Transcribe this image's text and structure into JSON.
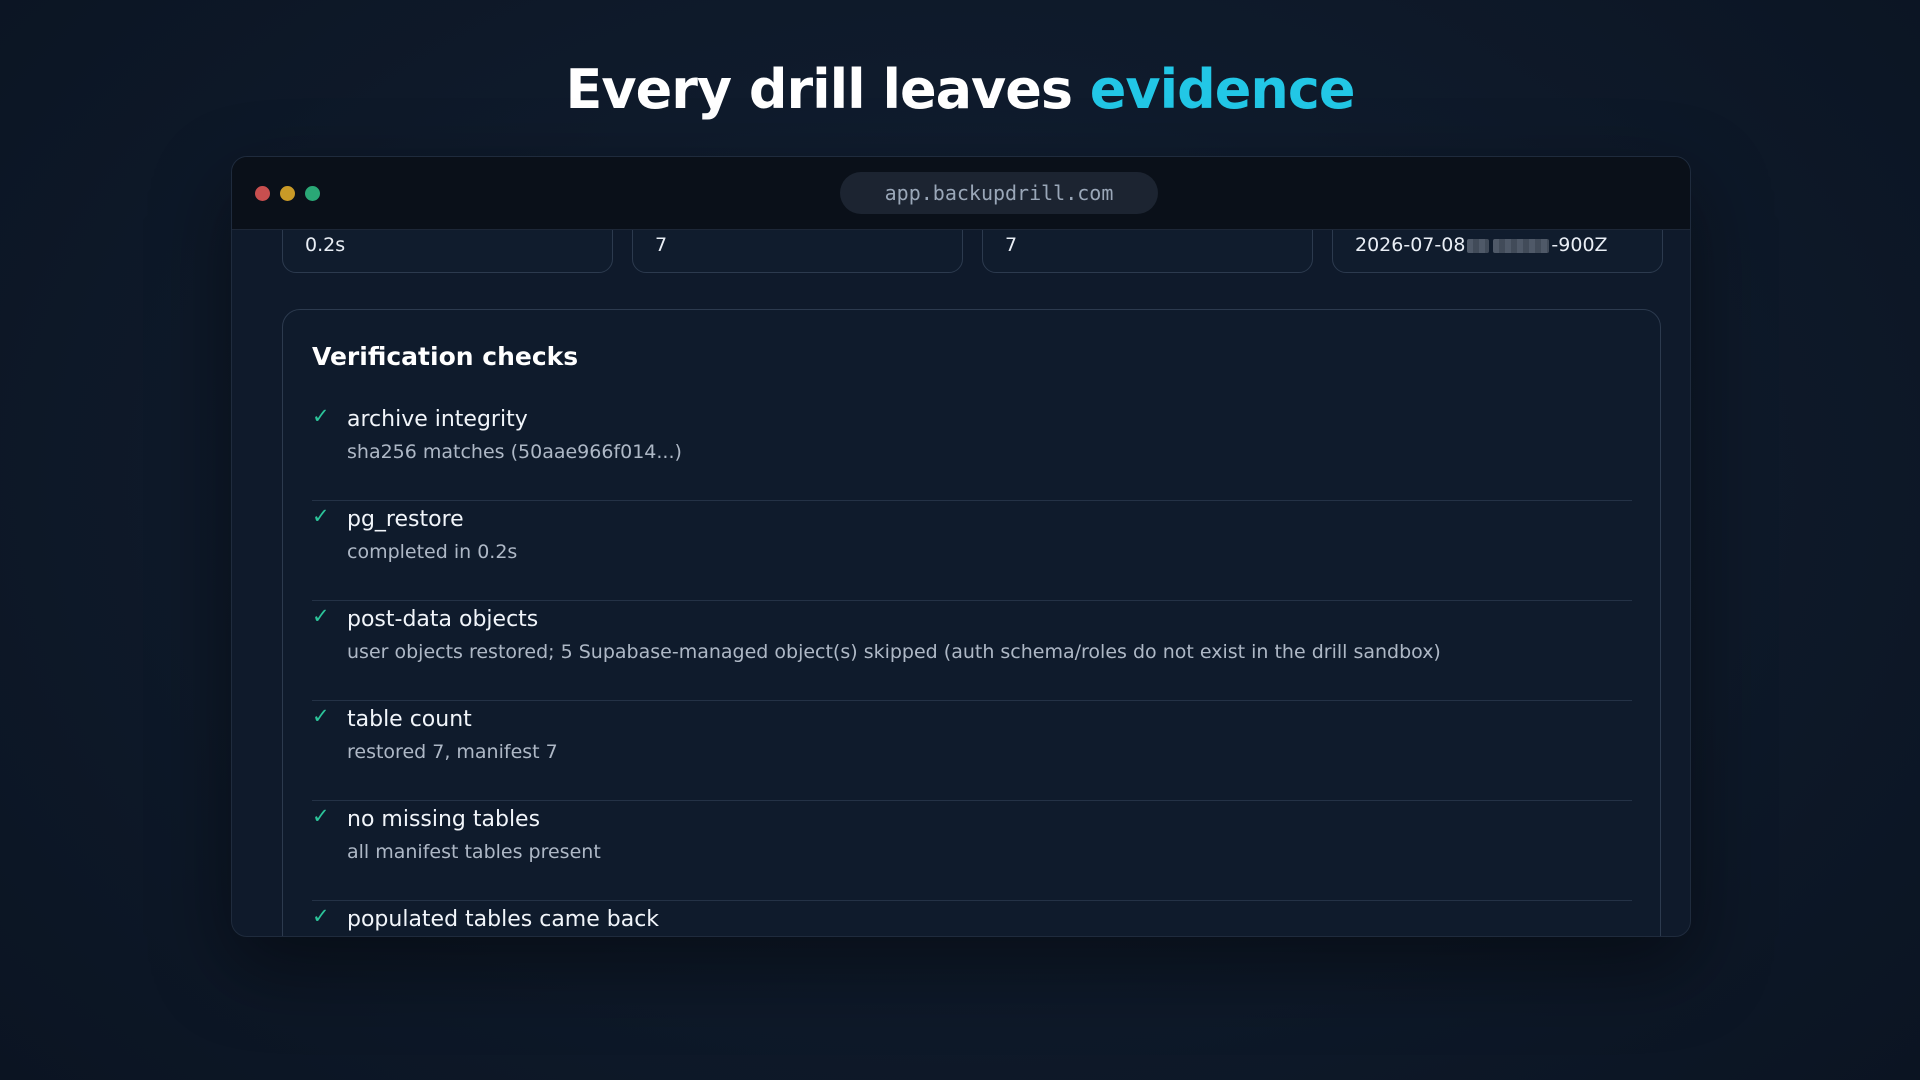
{
  "headline": {
    "main": "Every drill leaves ",
    "accent": "evidence"
  },
  "window": {
    "url": "app.backupdrill.com"
  },
  "stats": [
    {
      "value": "0.2s"
    },
    {
      "value": "7"
    },
    {
      "value": "7"
    },
    {
      "value_prefix": "2026-07-08",
      "value_suffix": "-900Z"
    }
  ],
  "checks": {
    "title": "Verification checks",
    "items": [
      {
        "name": "archive integrity",
        "detail": "sha256 matches (50aae966f014...)",
        "status_icon": "check-icon"
      },
      {
        "name": "pg_restore",
        "detail": "completed in 0.2s",
        "status_icon": "check-icon"
      },
      {
        "name": "post-data objects",
        "detail": "user objects restored; 5 Supabase-managed object(s) skipped (auth schema/roles do not exist in the drill sandbox)",
        "status_icon": "check-icon"
      },
      {
        "name": "table count",
        "detail": "restored 7, manifest 7",
        "status_icon": "check-icon"
      },
      {
        "name": "no missing tables",
        "detail": "all manifest tables present",
        "status_icon": "check-icon"
      },
      {
        "name": "populated tables came back",
        "detail": "",
        "status_icon": "check-icon"
      }
    ]
  },
  "colors": {
    "accent": "#22c7e6",
    "success": "#2cc49a",
    "background": "#0f1b2c"
  }
}
